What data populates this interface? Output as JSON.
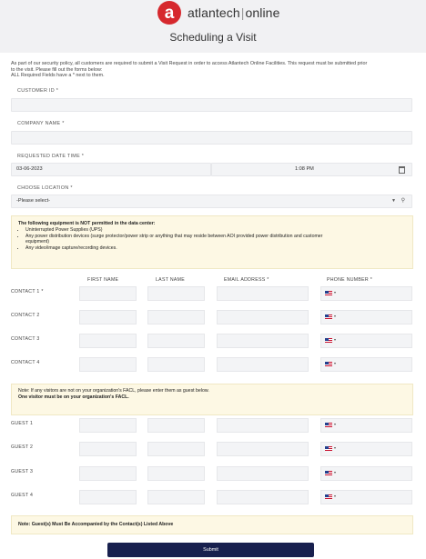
{
  "brand": {
    "logo_letter": "a",
    "name_left": "atlantech",
    "separator": "|",
    "name_right": "online",
    "accent_color": "#d6282d"
  },
  "page_title": "Scheduling a Visit",
  "intro": {
    "line1": "As part of our security policy, all customers are required to submit a Visit Request in order to access Atlantech Online Facilities. This request must be submitted prior",
    "line2": "to the visit. Please fill out the forms below:",
    "line3": "ALL Required Fields have a * next to them."
  },
  "fields": {
    "customer_id_label": "CUSTOMER ID *",
    "company_name_label": "COMPANY NAME *",
    "requested_datetime_label": "REQUESTED DATE TIME *",
    "date_value": "03-06-2023",
    "time_value": "1:08 PM",
    "location_label": "CHOOSE LOCATION *",
    "location_placeholder": "-Please select-"
  },
  "equipment_notice": {
    "heading": "The following equipment is NOT permitted in the data center:",
    "items": [
      "Uninterrupted Power Supplies (UPS)",
      "Any power distribution devices (surge protector/power strip or anything that may reside between AOI provided power distribution and customer",
      "equipment)",
      "Any video/image capture/recording devices."
    ]
  },
  "contacts_table": {
    "columns": [
      "FIRST NAME",
      "LAST NAME",
      "EMAIL ADDRESS *",
      "PHONE NUMBER *"
    ],
    "rows": [
      "CONTACT 1 *",
      "CONTACT 2",
      "CONTACT 3",
      "CONTACT 4"
    ]
  },
  "guest_notice": {
    "line1": "Note: If any visitors are not on your organization's FACL, please enter them as guest below.",
    "line2": "One visitor must be on your organization's FACL."
  },
  "guests_table": {
    "rows": [
      "GUEST 1",
      "GUEST 2",
      "GUEST 3",
      "GUEST 4"
    ]
  },
  "guest_accompany_note": "Note: Guest(s) Must Be Accompanied by the Contact(s) Listed Above",
  "submit_label": "Submit",
  "icons": {
    "calendar": "calendar-icon",
    "location_pin": "map-pin-icon",
    "flag": "us-flag-icon"
  }
}
